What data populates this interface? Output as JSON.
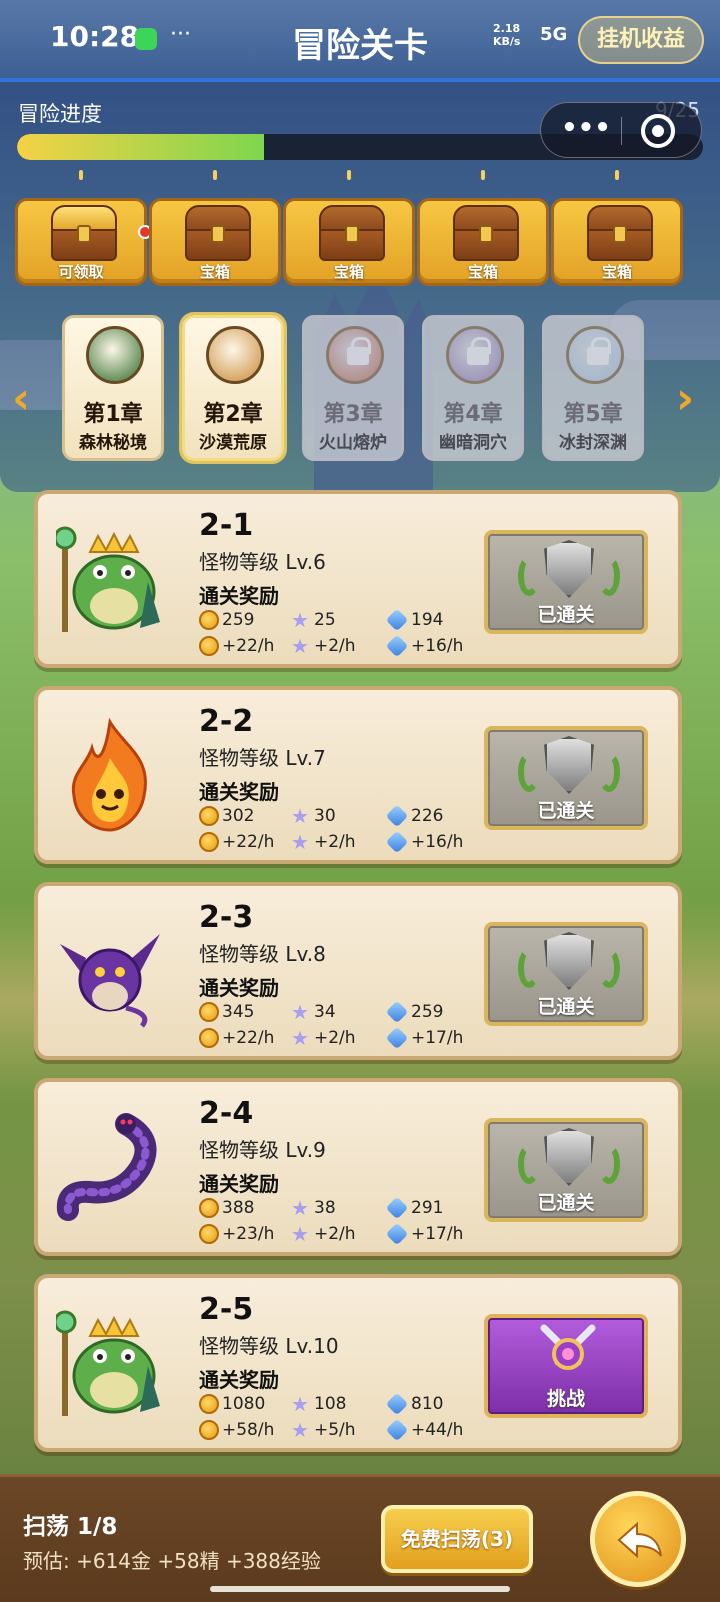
{
  "status": {
    "time": "10:28",
    "net_speed_value": "2.18",
    "net_speed_unit": "KB/s",
    "signal": "5G",
    "more_dots": "···"
  },
  "header": {
    "title": "冒险关卡",
    "offline_label": "挂机收益"
  },
  "progress": {
    "label": "冒险进度",
    "count": "9/25",
    "fraction": 0.36
  },
  "capsule": {
    "more_icon": "more-icon",
    "close_icon": "target-close-icon"
  },
  "chests": [
    {
      "label": "可领取",
      "state": "claimable",
      "has_dot": true
    },
    {
      "label": "宝箱",
      "state": "closed"
    },
    {
      "label": "宝箱",
      "state": "closed"
    },
    {
      "label": "宝箱",
      "state": "closed"
    },
    {
      "label": "宝箱",
      "state": "closed"
    }
  ],
  "chapters": [
    {
      "num": "第1章",
      "name": "森林秘境",
      "state": "unlocked",
      "color": "#2e6b2a"
    },
    {
      "num": "第2章",
      "name": "沙漠荒原",
      "state": "selected",
      "color": "#c98b3a"
    },
    {
      "num": "第3章",
      "name": "火山熔炉",
      "state": "locked",
      "color": "#b4513a"
    },
    {
      "num": "第4章",
      "name": "幽暗洞穴",
      "state": "locked",
      "color": "#7e5ea8"
    },
    {
      "num": "第5章",
      "name": "冰封深渊",
      "state": "locked",
      "color": "#8fb0d4"
    }
  ],
  "levels": [
    {
      "title": "2-1",
      "monster": "怪物等级 Lv.6",
      "reward_title": "通关奖励",
      "gold": "259",
      "star": "25",
      "gem": "194",
      "gold_rate": "+22/h",
      "star_rate": "+2/h",
      "gem_rate": "+16/h",
      "button": "已通关",
      "state": "cleared",
      "monster_icon": "frog-king"
    },
    {
      "title": "2-2",
      "monster": "怪物等级 Lv.7",
      "reward_title": "通关奖励",
      "gold": "302",
      "star": "30",
      "gem": "226",
      "gold_rate": "+22/h",
      "star_rate": "+2/h",
      "gem_rate": "+16/h",
      "button": "已通关",
      "state": "cleared",
      "monster_icon": "fire-spirit"
    },
    {
      "title": "2-3",
      "monster": "怪物等级 Lv.8",
      "reward_title": "通关奖励",
      "gold": "345",
      "star": "34",
      "gem": "259",
      "gold_rate": "+22/h",
      "star_rate": "+2/h",
      "gem_rate": "+17/h",
      "button": "已通关",
      "state": "cleared",
      "monster_icon": "bat-dragon"
    },
    {
      "title": "2-4",
      "monster": "怪物等级 Lv.9",
      "reward_title": "通关奖励",
      "gold": "388",
      "star": "38",
      "gem": "291",
      "gold_rate": "+23/h",
      "star_rate": "+2/h",
      "gem_rate": "+17/h",
      "button": "已通关",
      "state": "cleared",
      "monster_icon": "centipede"
    },
    {
      "title": "2-5",
      "monster": "怪物等级 Lv.10",
      "reward_title": "通关奖励",
      "gold": "1080",
      "star": "108",
      "gem": "810",
      "gold_rate": "+58/h",
      "star_rate": "+5/h",
      "gem_rate": "+44/h",
      "button": "挑战",
      "state": "challenge",
      "monster_icon": "frog-king"
    }
  ],
  "bottom": {
    "sweep_title": "扫荡 1/8",
    "estimate": "预估: +614金 +58精 +388经验",
    "free_sweep": "免费扫荡(3)",
    "back_icon": "back-arrow-icon"
  }
}
